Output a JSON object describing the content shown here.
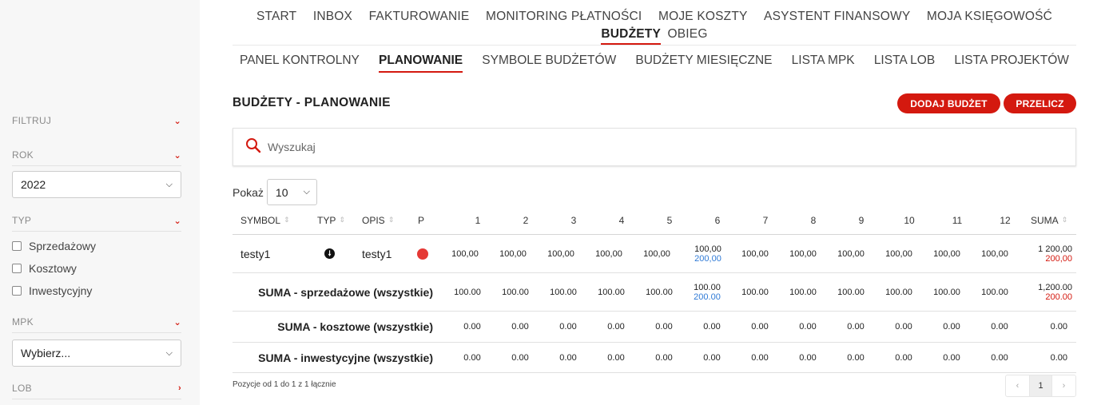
{
  "sidebar": {
    "filter_label": "FILTRUJ",
    "year_label": "ROK",
    "year_value": "2022",
    "type_label": "TYP",
    "type_options": [
      "Sprzedażowy",
      "Kosztowy",
      "Inwestycyjny"
    ],
    "mpk_label": "MPK",
    "mpk_value": "Wybierz...",
    "lob_label": "LOB"
  },
  "nav": {
    "main": [
      "START",
      "INBOX",
      "FAKTUROWANIE",
      "MONITORING PŁATNOŚCI",
      "MOJE KOSZTY",
      "ASYSTENT FINANSOWY",
      "MOJA KSIĘGOWOŚĆ"
    ],
    "main_active": "BUDŻETY",
    "main_last": "OBIEG",
    "sub": [
      "PANEL KONTROLNY",
      "PLANOWANIE",
      "SYMBOLE BUDŻETÓW",
      "BUDŻETY MIESIĘCZNE",
      "LISTA MPK",
      "LISTA LOB",
      "LISTA PROJEKTÓW"
    ],
    "sub_active_index": 1
  },
  "page": {
    "title": "BUDŻETY - PLANOWANIE",
    "add_button": "DODAJ BUDŻET",
    "recalc_button": "PRZELICZ",
    "search_placeholder": "Wyszukaj",
    "show_label": "Pokaż",
    "show_value": "10"
  },
  "table": {
    "headers": {
      "symbol": "SYMBOL",
      "type": "TYP",
      "desc": "OPIS",
      "p": "P",
      "months": [
        "1",
        "2",
        "3",
        "4",
        "5",
        "6",
        "7",
        "8",
        "9",
        "10",
        "11",
        "12"
      ],
      "sum": "SUMA"
    },
    "row": {
      "symbol": "testy1",
      "desc": "testy1",
      "months": [
        "100,00",
        "100,00",
        "100,00",
        "100,00",
        "100,00",
        "100,00",
        "100,00",
        "100,00",
        "100,00",
        "100,00",
        "100,00",
        "100,00"
      ],
      "month6_extra": "200,00",
      "sum": "1 200,00",
      "sum_extra": "200,00"
    },
    "sum_sales": {
      "label": "SUMA - sprzedażowe (wszystkie)",
      "months": [
        "100.00",
        "100.00",
        "100.00",
        "100.00",
        "100.00",
        "100.00",
        "100.00",
        "100.00",
        "100.00",
        "100.00",
        "100.00",
        "100.00"
      ],
      "month6_extra": "200.00",
      "sum": "1,200.00",
      "sum_extra": "200.00"
    },
    "sum_costs": {
      "label": "SUMA - kosztowe (wszystkie)",
      "months": [
        "0.00",
        "0.00",
        "0.00",
        "0.00",
        "0.00",
        "0.00",
        "0.00",
        "0.00",
        "0.00",
        "0.00",
        "0.00",
        "0.00"
      ],
      "sum": "0.00"
    },
    "sum_invest": {
      "label": "SUMA - inwestycyjne (wszystkie)",
      "months": [
        "0.00",
        "0.00",
        "0.00",
        "0.00",
        "0.00",
        "0.00",
        "0.00",
        "0.00",
        "0.00",
        "0.00",
        "0.00",
        "0.00"
      ],
      "sum": "0.00"
    }
  },
  "footer": {
    "info": "Pozycje od 1 do 1 z 1 łącznie",
    "prev": "‹",
    "page": "1",
    "next": "›"
  },
  "colors": {
    "accent": "#d4190f",
    "blue_value": "#2f7ad6",
    "sidebar_bg": "#f7f7f7"
  }
}
